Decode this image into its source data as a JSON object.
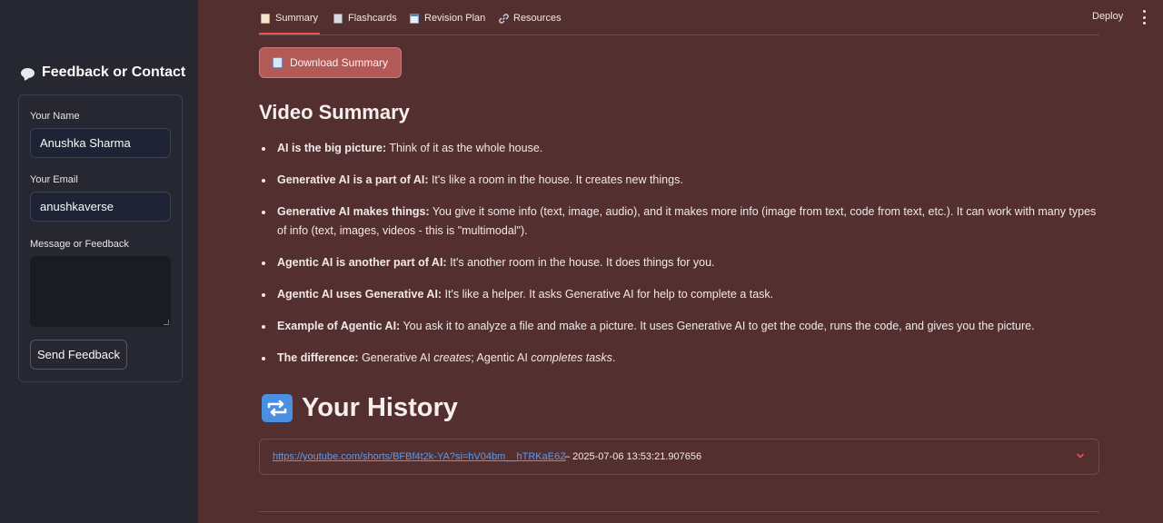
{
  "sidebar": {
    "title": "Feedback or Contact",
    "name_label": "Your Name",
    "name_value": "Anushka Sharma",
    "email_label": "Your Email",
    "email_value": "anushkaverse",
    "message_label": "Message or Feedback",
    "message_value": "",
    "send_label": "Send Feedback"
  },
  "tabs": [
    {
      "label": "Summary",
      "icon": "page-icon",
      "active": true
    },
    {
      "label": "Flashcards",
      "icon": "cards-icon",
      "active": false
    },
    {
      "label": "Revision Plan",
      "icon": "calendar-icon",
      "active": false
    },
    {
      "label": "Resources",
      "icon": "link-icon",
      "active": false
    }
  ],
  "header": {
    "deploy_label": "Deploy"
  },
  "download_label": "Download Summary",
  "summary": {
    "heading": "Video Summary",
    "bullets": [
      {
        "bold": "AI is the big picture:",
        "text": " Think of it as the whole house."
      },
      {
        "bold": "Generative AI is a part of AI:",
        "text": " It's like a room in the house. It creates new things."
      },
      {
        "bold": "Generative AI makes things:",
        "text": " You give it some info (text, image, audio), and it makes more info (image from text, code from text, etc.). It can work with many types of info (text, images, videos - this is \"multimodal\")."
      },
      {
        "bold": "Agentic AI is another part of AI:",
        "text": " It's another room in the house. It does things for you."
      },
      {
        "bold": "Agentic AI uses Generative AI:",
        "text": " It's like a helper. It asks Generative AI for help to complete a task."
      },
      {
        "bold": "Example of Agentic AI:",
        "text": " You ask it to analyze a file and make a picture. It uses Generative AI to get the code, runs the code, and gives you the picture."
      },
      {
        "bold": "The difference:",
        "text_a": " Generative AI ",
        "em_a": "creates",
        "text_b": "; Agentic AI ",
        "em_b": "completes tasks",
        "text_c": "."
      }
    ]
  },
  "history": {
    "heading": "Your History",
    "items": [
      {
        "url": "https://youtube.com/shorts/BFBf4t2k-YA?si=hV04bm__hTRKaE6Z",
        "timestamp": " – 2025-07-06 13:53:21.907656"
      }
    ]
  },
  "colors": {
    "background": "#532f30",
    "sidebar": "#262730",
    "accent": "#e85550",
    "link": "#5a9cf0"
  }
}
